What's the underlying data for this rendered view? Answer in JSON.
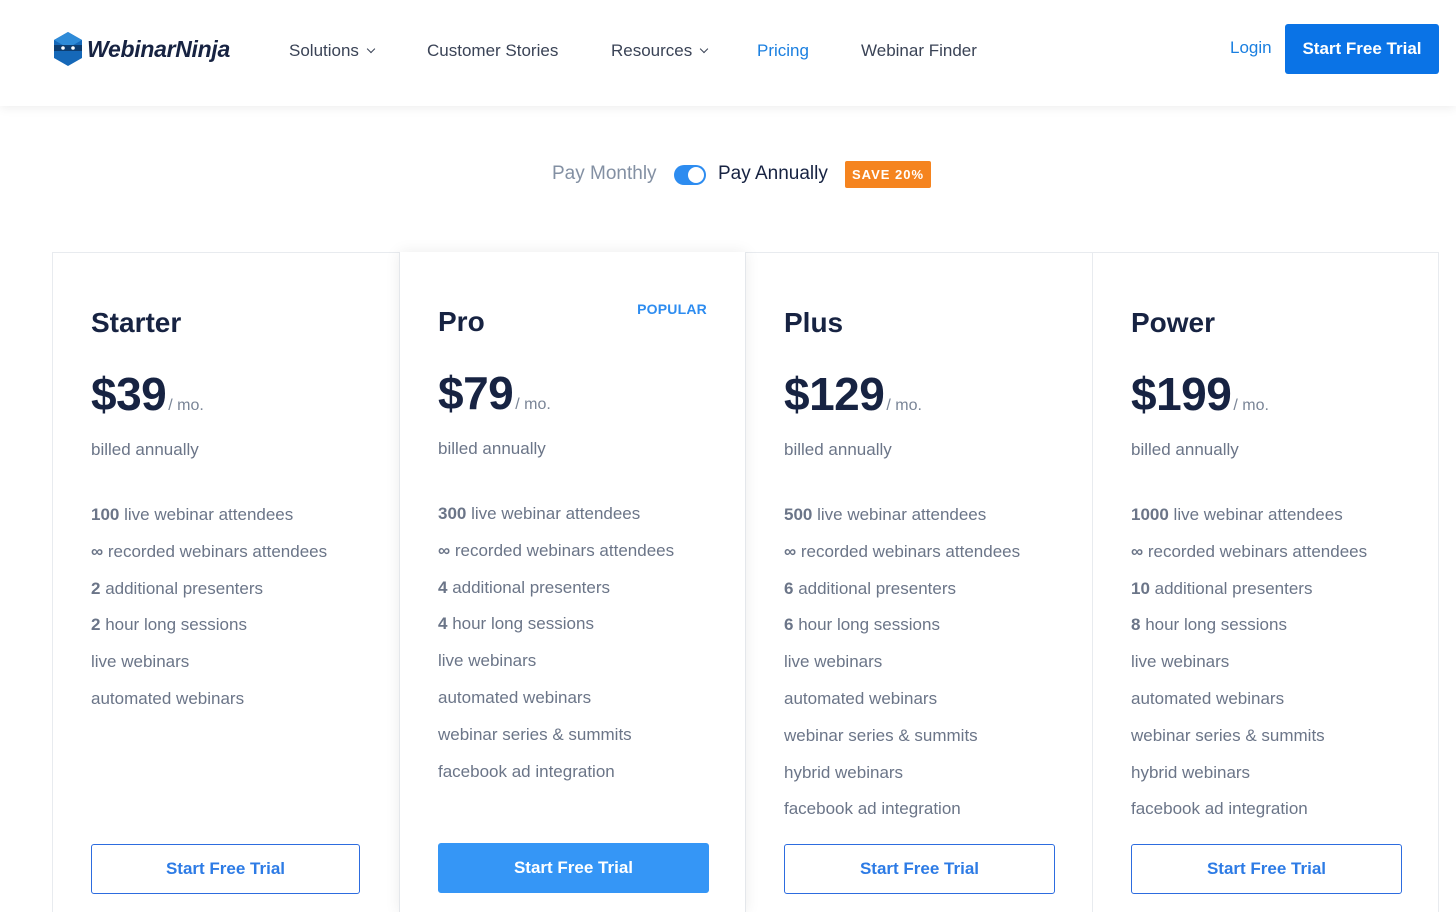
{
  "header": {
    "logo_text": "WebinarNinja",
    "nav": [
      {
        "label": "Solutions",
        "has_dropdown": true,
        "active": false
      },
      {
        "label": "Customer Stories",
        "has_dropdown": false,
        "active": false
      },
      {
        "label": "Resources",
        "has_dropdown": true,
        "active": false
      },
      {
        "label": "Pricing",
        "has_dropdown": false,
        "active": true
      },
      {
        "label": "Webinar Finder",
        "has_dropdown": false,
        "active": false
      }
    ],
    "login_label": "Login",
    "cta_label": "Start Free Trial"
  },
  "billing_toggle": {
    "monthly_label": "Pay Monthly",
    "annual_label": "Pay Annually",
    "selected": "annual",
    "save_badge": "SAVE 20%"
  },
  "plans": [
    {
      "name": "Starter",
      "badge": "",
      "price": "$39",
      "per": "/ mo.",
      "billed": "billed annually",
      "features": [
        {
          "strong": "100",
          "text": " live webinar attendees"
        },
        {
          "strong": "∞",
          "text": " recorded webinars attendees"
        },
        {
          "strong": "2",
          "text": " additional presenters"
        },
        {
          "strong": "2",
          "text": " hour long sessions"
        },
        {
          "strong": "",
          "text": "live webinars"
        },
        {
          "strong": "",
          "text": "automated webinars"
        }
      ],
      "cta_label": "Start Free Trial"
    },
    {
      "name": "Pro",
      "badge": "POPULAR",
      "price": "$79",
      "per": "/ mo.",
      "billed": "billed annually",
      "features": [
        {
          "strong": "300",
          "text": " live webinar attendees"
        },
        {
          "strong": "∞",
          "text": " recorded webinars attendees"
        },
        {
          "strong": "4",
          "text": " additional presenters"
        },
        {
          "strong": "4",
          "text": " hour long sessions"
        },
        {
          "strong": "",
          "text": "live webinars"
        },
        {
          "strong": "",
          "text": "automated webinars"
        },
        {
          "strong": "",
          "text": "webinar series & summits"
        },
        {
          "strong": "",
          "text": "facebook ad integration"
        }
      ],
      "cta_label": "Start Free Trial"
    },
    {
      "name": "Plus",
      "badge": "",
      "price": "$129",
      "per": "/ mo.",
      "billed": "billed annually",
      "features": [
        {
          "strong": "500",
          "text": " live webinar attendees"
        },
        {
          "strong": "∞",
          "text": " recorded webinars attendees"
        },
        {
          "strong": "6",
          "text": " additional presenters"
        },
        {
          "strong": "6",
          "text": " hour long sessions"
        },
        {
          "strong": "",
          "text": "live webinars"
        },
        {
          "strong": "",
          "text": "automated webinars"
        },
        {
          "strong": "",
          "text": "webinar series & summits"
        },
        {
          "strong": "",
          "text": "hybrid webinars"
        },
        {
          "strong": "",
          "text": "facebook ad integration"
        }
      ],
      "cta_label": "Start Free Trial"
    },
    {
      "name": "Power",
      "badge": "",
      "price": "$199",
      "per": "/ mo.",
      "billed": "billed annually",
      "features": [
        {
          "strong": "1000",
          "text": " live webinar attendees"
        },
        {
          "strong": "∞",
          "text": " recorded webinars attendees"
        },
        {
          "strong": "10",
          "text": " additional presenters"
        },
        {
          "strong": "8",
          "text": " hour long sessions"
        },
        {
          "strong": "",
          "text": "live webinars"
        },
        {
          "strong": "",
          "text": "automated webinars"
        },
        {
          "strong": "",
          "text": "webinar series & summits"
        },
        {
          "strong": "",
          "text": "hybrid webinars"
        },
        {
          "strong": "",
          "text": "facebook ad integration"
        }
      ],
      "cta_label": "Start Free Trial"
    }
  ],
  "colors": {
    "accent": "#0a73e6",
    "link": "#1a7fe0",
    "badge": "#f5841f",
    "heading": "#172342",
    "muted": "#6b7588"
  },
  "icons": {
    "logo": "ninja-hexagon-icon",
    "dropdown": "chevron-down-icon"
  }
}
